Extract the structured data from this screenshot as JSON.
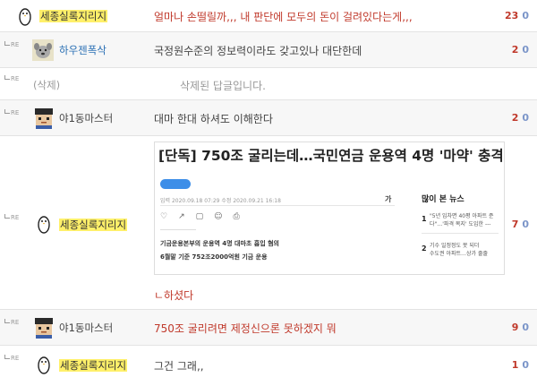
{
  "re_label": "RE",
  "comments": [
    {
      "nick": "세종실록지리지",
      "content": "얼마나 손떨릴까,,, 내 판단에 모두의 돈이 걸려있다는게,,,",
      "up": "23",
      "down": "0"
    },
    {
      "nick": "하우젠폭삭",
      "content": "국정원수준의 정보력이라도 갖고있나 대단한데",
      "up": "2",
      "down": "0"
    },
    {
      "nick": "(삭제)",
      "content": "삭제된 답글입니다."
    },
    {
      "nick": "야1동마스터",
      "content": "대마 한대 하셔도 이해한다",
      "up": "2",
      "down": "0"
    },
    {
      "nick": "세종실록지리지",
      "content": "ㄴ하셨다",
      "up": "7",
      "down": "0",
      "card": {
        "headline": "[단독] 750조 굴리는데…국민연금 운용역 4명 '마약' 충격",
        "meta": "입력 2020.09.18 07:29   수정 2020.09.21 16:18",
        "brand": "가",
        "side_title": "많이 본 뉴스",
        "lede_1": "기금운용본부의 운용역 4명 대마초 흡입 혐의",
        "lede_2": "6월말 기준 752조2000억원 기금 운용",
        "side_items": [
          {
            "num": "1",
            "text1": "\"5년 임차면 40평 아파트 준",
            "text2": "다\"…'파격 복지' 도입한 ---"
          },
          {
            "num": "2",
            "text1": "기수 일정정도 못 되더",
            "text2": "수도권 아파트…상가 줄줄"
          }
        ]
      }
    },
    {
      "nick": "야1동마스터",
      "content": "750조 굴리려면 제정신으론 못하겠지 뭐",
      "up": "9",
      "down": "0"
    },
    {
      "nick": "세종실록지리지",
      "content": "그건 그래,,",
      "up": "1",
      "down": "0"
    }
  ]
}
